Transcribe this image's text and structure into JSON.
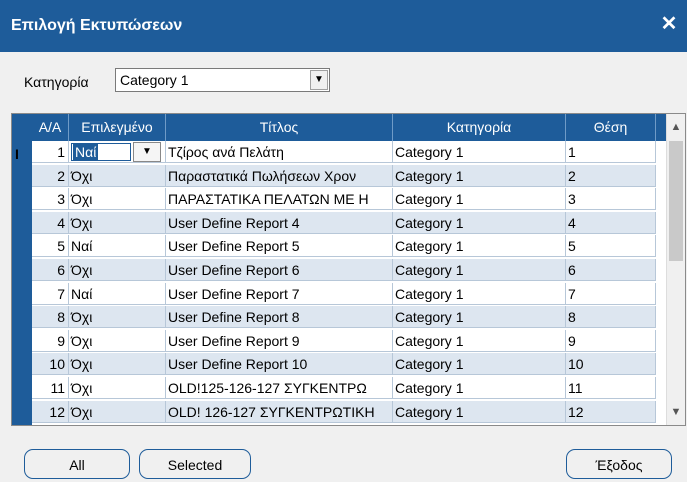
{
  "window": {
    "title": "Επιλογή Εκτυπώσεων",
    "close_glyph": "✕"
  },
  "category": {
    "label": "Κατηγορία",
    "value": "Category 1"
  },
  "grid": {
    "columns": [
      "Α/Α",
      "Επιλεγμένο",
      "Τίτλος",
      "Κατηγορία",
      "Θέση"
    ],
    "row_indicator": "I",
    "rows": [
      {
        "no": "1",
        "selected": "Ναί",
        "title": "Τζίρος ανά Πελάτη",
        "category": "Category 1",
        "position": "1"
      },
      {
        "no": "2",
        "selected": "Όχι",
        "title": "Παραστατικά Πωλήσεων Χρον",
        "category": "Category 1",
        "position": "2"
      },
      {
        "no": "3",
        "selected": "Όχι",
        "title": "ΠΑΡΑΣΤΑΤΙΚΑ ΠΕΛΑΤΩΝ ΜΕ Η",
        "category": "Category 1",
        "position": "3"
      },
      {
        "no": "4",
        "selected": "Όχι",
        "title": "User Define Report 4",
        "category": "Category 1",
        "position": "4"
      },
      {
        "no": "5",
        "selected": "Ναί",
        "title": "User Define Report 5",
        "category": "Category 1",
        "position": "5"
      },
      {
        "no": "6",
        "selected": "Όχι",
        "title": "User Define Report 6",
        "category": "Category 1",
        "position": "6"
      },
      {
        "no": "7",
        "selected": "Ναί",
        "title": "User Define Report 7",
        "category": "Category 1",
        "position": "7"
      },
      {
        "no": "8",
        "selected": "Όχι",
        "title": "User Define Report 8",
        "category": "Category 1",
        "position": "8"
      },
      {
        "no": "9",
        "selected": "Όχι",
        "title": "User Define Report 9",
        "category": "Category 1",
        "position": "9"
      },
      {
        "no": "10",
        "selected": "Όχι",
        "title": "User Define Report 10",
        "category": "Category 1",
        "position": "10"
      },
      {
        "no": "11",
        "selected": "Όχι",
        "title": "OLD!125-126-127  ΣΥΓΚΕΝΤΡΩ",
        "category": "Category 1",
        "position": "11"
      },
      {
        "no": "12",
        "selected": "Όχι",
        "title": "OLD! 126-127 ΣΥΓΚΕΝΤΡΩΤΙΚΗ",
        "category": "Category 1",
        "position": "12"
      }
    ]
  },
  "buttons": {
    "all": "All",
    "selected": "Selected",
    "exit": "Έξοδος"
  },
  "colors": {
    "accent": "#1e5c9a",
    "alt_row": "#dde6f0"
  }
}
